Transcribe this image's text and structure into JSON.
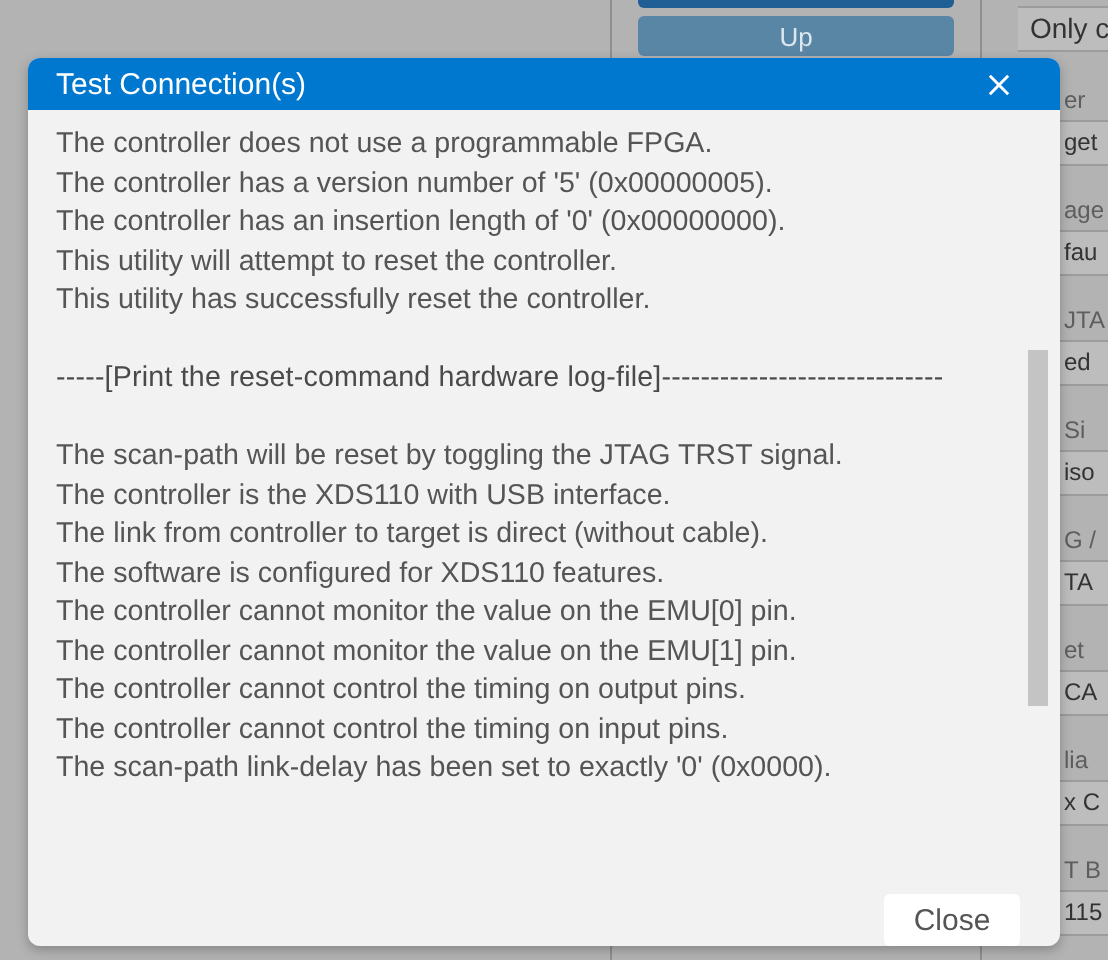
{
  "background": {
    "up_button": {
      "label": "Up",
      "disabled": true
    },
    "right_fragments": [
      {
        "kind": "field",
        "text": "Only c"
      },
      {
        "kind": "label",
        "text": "er"
      },
      {
        "kind": "field",
        "text": "get"
      },
      {
        "kind": "label",
        "text": "age"
      },
      {
        "kind": "field",
        "text": "fau"
      },
      {
        "kind": "label",
        "text": "JTA"
      },
      {
        "kind": "field",
        "text": "ed"
      },
      {
        "kind": "label",
        "text": "Si"
      },
      {
        "kind": "field",
        "text": "iso"
      },
      {
        "kind": "label",
        "text": "G /"
      },
      {
        "kind": "field",
        "text": "TA"
      },
      {
        "kind": "label",
        "text": "et"
      },
      {
        "kind": "field",
        "text": "CA"
      },
      {
        "kind": "label",
        "text": "lia"
      },
      {
        "kind": "field",
        "text": "x C"
      },
      {
        "kind": "label",
        "text": "T B"
      },
      {
        "kind": "field",
        "text": "115"
      }
    ]
  },
  "dialog": {
    "title": "Test Connection(s)",
    "log": [
      {
        "kind": "text",
        "lines": [
          "The controller does not use a programmable FPGA.",
          "The controller has a version number of '5' (0x00000005).",
          "The controller has an insertion length of '0' (0x00000000).",
          "This utility will attempt to reset the controller.",
          "This utility has successfully reset the controller."
        ]
      },
      {
        "kind": "header",
        "lines": [
          "-----[Print the reset-command hardware log-file]-----------------------------"
        ]
      },
      {
        "kind": "text",
        "lines": [
          "The scan-path will be reset by toggling the JTAG TRST signal.",
          "The controller is the XDS110 with USB interface.",
          "The link from controller to target is direct (without cable).",
          "The software is configured for XDS110 features.",
          "The controller cannot monitor the value on the EMU[0] pin.",
          "The controller cannot monitor the value on the EMU[1] pin.",
          "The controller cannot control the timing on output pins.",
          "The controller cannot control the timing on input pins.",
          "The scan-path link-delay has been set to exactly '0' (0x0000)."
        ]
      }
    ],
    "buttons": [
      {
        "label": "Close"
      }
    ]
  }
}
